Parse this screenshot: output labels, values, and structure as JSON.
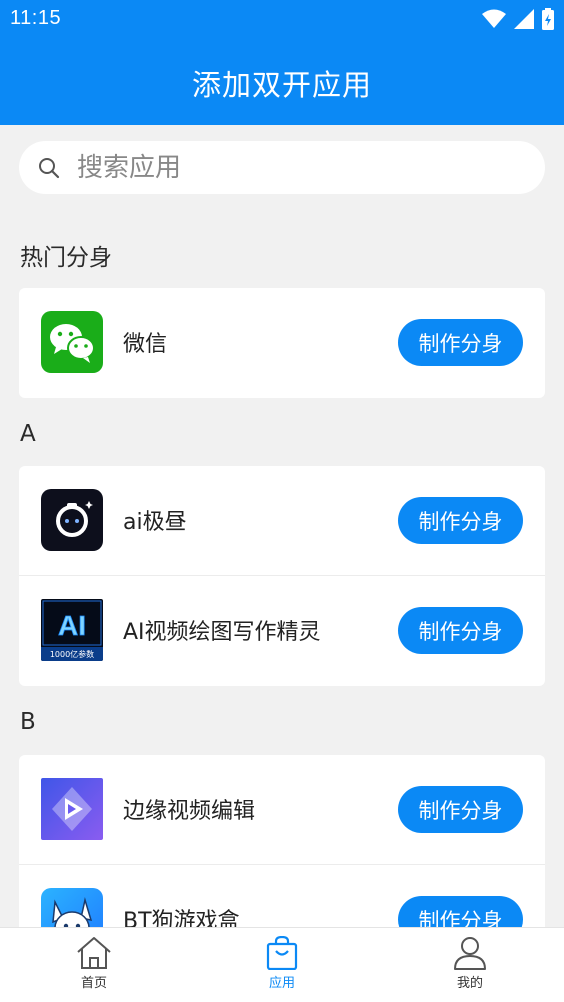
{
  "status_bar": {
    "time": "11:15"
  },
  "header": {
    "title": "添加双开应用"
  },
  "search": {
    "placeholder": "搜索应用"
  },
  "sections": {
    "hot": {
      "title": "热门分身",
      "apps": [
        {
          "name": "微信"
        }
      ]
    },
    "a": {
      "title": "A",
      "apps": [
        {
          "name": "ai极昼"
        },
        {
          "name": "AI视频绘图写作精灵",
          "icon_text": "AI",
          "icon_caption": "1000亿参数"
        }
      ]
    },
    "b": {
      "title": "B",
      "apps": [
        {
          "name": "边缘视频编辑"
        },
        {
          "name": "BT狗游戏盒"
        }
      ]
    }
  },
  "make_clone_label": "制作分身",
  "bottom_nav": {
    "home": "首页",
    "apps": "应用",
    "me": "我的"
  },
  "colors": {
    "primary": "#0b89f5",
    "wechat": "#1aad19"
  }
}
